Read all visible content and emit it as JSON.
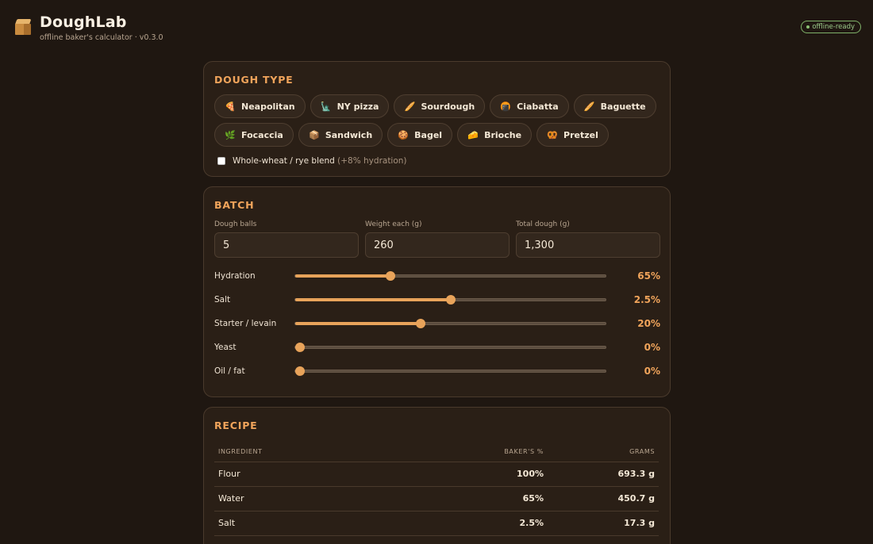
{
  "app": {
    "title": "DoughLab",
    "subtitle": "offline baker's calculator · v0.3.0",
    "status": "offline-ready",
    "accent_color": "#f0a45b",
    "status_color": "#8cc274"
  },
  "dough_type": {
    "title": "DOUGH TYPE",
    "chips": [
      {
        "label": "Neapolitan",
        "icon": "🍕"
      },
      {
        "label": "NY pizza",
        "icon": "🗽"
      },
      {
        "label": "Sourdough",
        "icon": "🥖"
      },
      {
        "label": "Ciabatta",
        "icon": "🍘"
      },
      {
        "label": "Baguette",
        "icon": "🥖"
      },
      {
        "label": "Focaccia",
        "icon": "🌿"
      },
      {
        "label": "Sandwich",
        "icon": "📦"
      },
      {
        "label": "Bagel",
        "icon": "🍪"
      },
      {
        "label": "Brioche",
        "icon": "🧀"
      },
      {
        "label": "Pretzel",
        "icon": "🥨"
      }
    ],
    "blend_label": "Whole-wheat / rye blend",
    "blend_note": "(+8% hydration)",
    "blend_checked": false
  },
  "batch": {
    "title": "BATCH",
    "fields": [
      {
        "label": "Dough balls",
        "value": "5"
      },
      {
        "label": "Weight each (g)",
        "value": "260"
      },
      {
        "label": "Total dough (g)",
        "value": "1,300"
      }
    ],
    "sliders": [
      {
        "label": "Hydration",
        "value": "65%",
        "fraction": 0.307
      },
      {
        "label": "Salt",
        "value": "2.5%",
        "fraction": 0.5
      },
      {
        "label": "Starter / levain",
        "value": "20%",
        "fraction": 0.403
      },
      {
        "label": "Yeast",
        "value": "0%",
        "fraction": 0
      },
      {
        "label": "Oil / fat",
        "value": "0%",
        "fraction": 0
      }
    ]
  },
  "recipe": {
    "title": "RECIPE",
    "columns": [
      "INGREDIENT",
      "BAKER'S %",
      "GRAMS"
    ],
    "rows": [
      {
        "ingredient": "Flour",
        "percent": "100%",
        "grams": "693.3 g"
      },
      {
        "ingredient": "Water",
        "percent": "65%",
        "grams": "450.7 g"
      },
      {
        "ingredient": "Salt",
        "percent": "2.5%",
        "grams": "17.3 g"
      }
    ]
  }
}
